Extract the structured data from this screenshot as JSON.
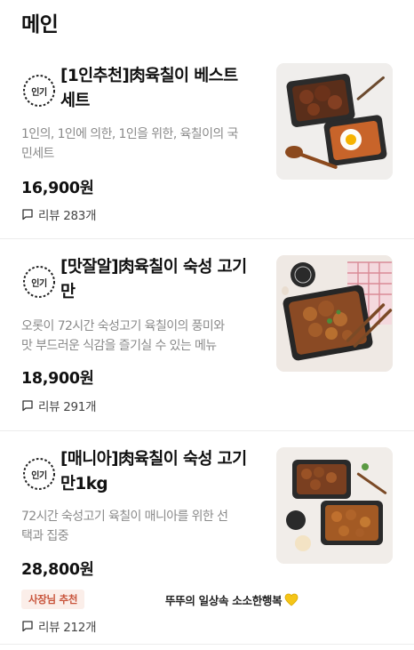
{
  "section": {
    "title": "메인"
  },
  "colors": {
    "owner_tag_bg": "#fbeee9",
    "owner_tag_text": "#c8533a",
    "heart": "#f5c518"
  },
  "items": [
    {
      "badge": "인기",
      "badge_icon": "popular-badge-icon",
      "title": "[1인추천]肉육칠이 베스트\n세트",
      "description": "1인의, 1인에 의한, 1인을 위한, 육칠이의 국\n민세트",
      "price": "16,900원",
      "review_icon": "comment-icon",
      "reviews": "리뷰 283개"
    },
    {
      "badge": "인기",
      "badge_icon": "popular-badge-icon",
      "title": "[맛잘알]肉육칠이 숙성 고기\n만",
      "description": "오롯이 72시간 숙성고기 육칠이의 풍미와\n맛 부드러운 식감을 즐기실 수  있는 메뉴",
      "price": "18,900원",
      "review_icon": "comment-icon",
      "reviews": "리뷰 291개"
    },
    {
      "badge": "인기",
      "badge_icon": "popular-badge-icon",
      "title": "[매니아]肉육칠이 숙성 고기\n만1kg",
      "description": "72시간 숙성고기 육칠이 매니아를 위한 선\n택과 집중",
      "price": "28,800원",
      "owner_tag": "사장님 추천",
      "owner_comment": "뚜뚜의 일상속 소소한행복",
      "owner_comment_icon": "yellow-heart-icon",
      "review_icon": "comment-icon",
      "reviews": "리뷰 212개"
    }
  ]
}
